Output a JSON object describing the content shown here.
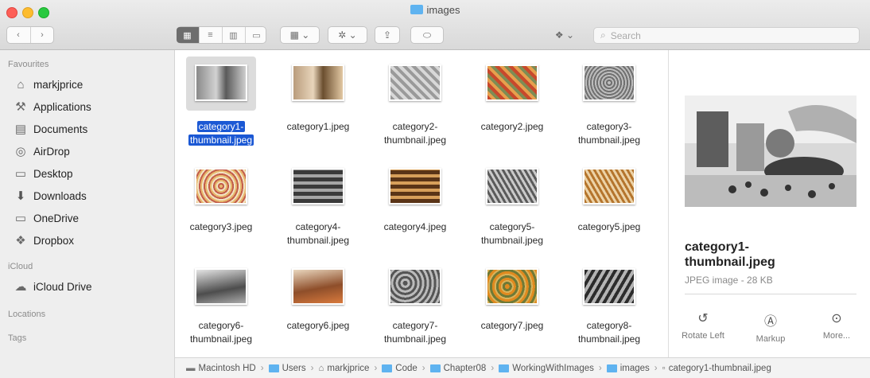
{
  "window": {
    "title": "images"
  },
  "toolbar": {
    "back_icon": "chevron-left-icon",
    "forward_icon": "chevron-right-icon",
    "search_placeholder": "Search"
  },
  "sidebar": {
    "favourites_label": "Favourites",
    "favourites": [
      {
        "label": "markjprice",
        "icon": "home-icon"
      },
      {
        "label": "Applications",
        "icon": "applications-icon"
      },
      {
        "label": "Documents",
        "icon": "documents-icon"
      },
      {
        "label": "AirDrop",
        "icon": "airdrop-icon"
      },
      {
        "label": "Desktop",
        "icon": "desktop-icon"
      },
      {
        "label": "Downloads",
        "icon": "downloads-icon"
      },
      {
        "label": "OneDrive",
        "icon": "folder-icon"
      },
      {
        "label": "Dropbox",
        "icon": "dropbox-icon"
      }
    ],
    "icloud_label": "iCloud",
    "icloud_items": [
      {
        "label": "iCloud Drive",
        "icon": "cloud-icon"
      }
    ],
    "locations_label": "Locations",
    "tags_label": "Tags"
  },
  "files": [
    {
      "name1": "category1-",
      "name2": "thumbnail.jpeg",
      "selected": true
    },
    {
      "name1": "category1.jpeg",
      "name2": ""
    },
    {
      "name1": "category2-",
      "name2": "thumbnail.jpeg"
    },
    {
      "name1": "category2.jpeg",
      "name2": ""
    },
    {
      "name1": "category3-",
      "name2": "thumbnail.jpeg"
    },
    {
      "name1": "category3.jpeg",
      "name2": ""
    },
    {
      "name1": "category4-",
      "name2": "thumbnail.jpeg"
    },
    {
      "name1": "category4.jpeg",
      "name2": ""
    },
    {
      "name1": "category5-",
      "name2": "thumbnail.jpeg"
    },
    {
      "name1": "category5.jpeg",
      "name2": ""
    },
    {
      "name1": "category6-",
      "name2": "thumbnail.jpeg"
    },
    {
      "name1": "category6.jpeg",
      "name2": ""
    },
    {
      "name1": "category7-",
      "name2": "thumbnail.jpeg"
    },
    {
      "name1": "category7.jpeg",
      "name2": ""
    },
    {
      "name1": "category8-",
      "name2": "thumbnail.jpeg"
    }
  ],
  "preview": {
    "name_line1": "category1-",
    "name_line2": "thumbnail.jpeg",
    "kind": "JPEG image - 28 KB",
    "actions": [
      {
        "label": "Rotate Left",
        "icon": "rotate-left-icon"
      },
      {
        "label": "Markup",
        "icon": "markup-icon"
      },
      {
        "label": "More...",
        "icon": "more-icon"
      }
    ]
  },
  "path": [
    "Macintosh HD",
    "Users",
    "markjprice",
    "Code",
    "Chapter08",
    "WorkingWithImages",
    "images",
    "category1-thumbnail.jpeg"
  ]
}
